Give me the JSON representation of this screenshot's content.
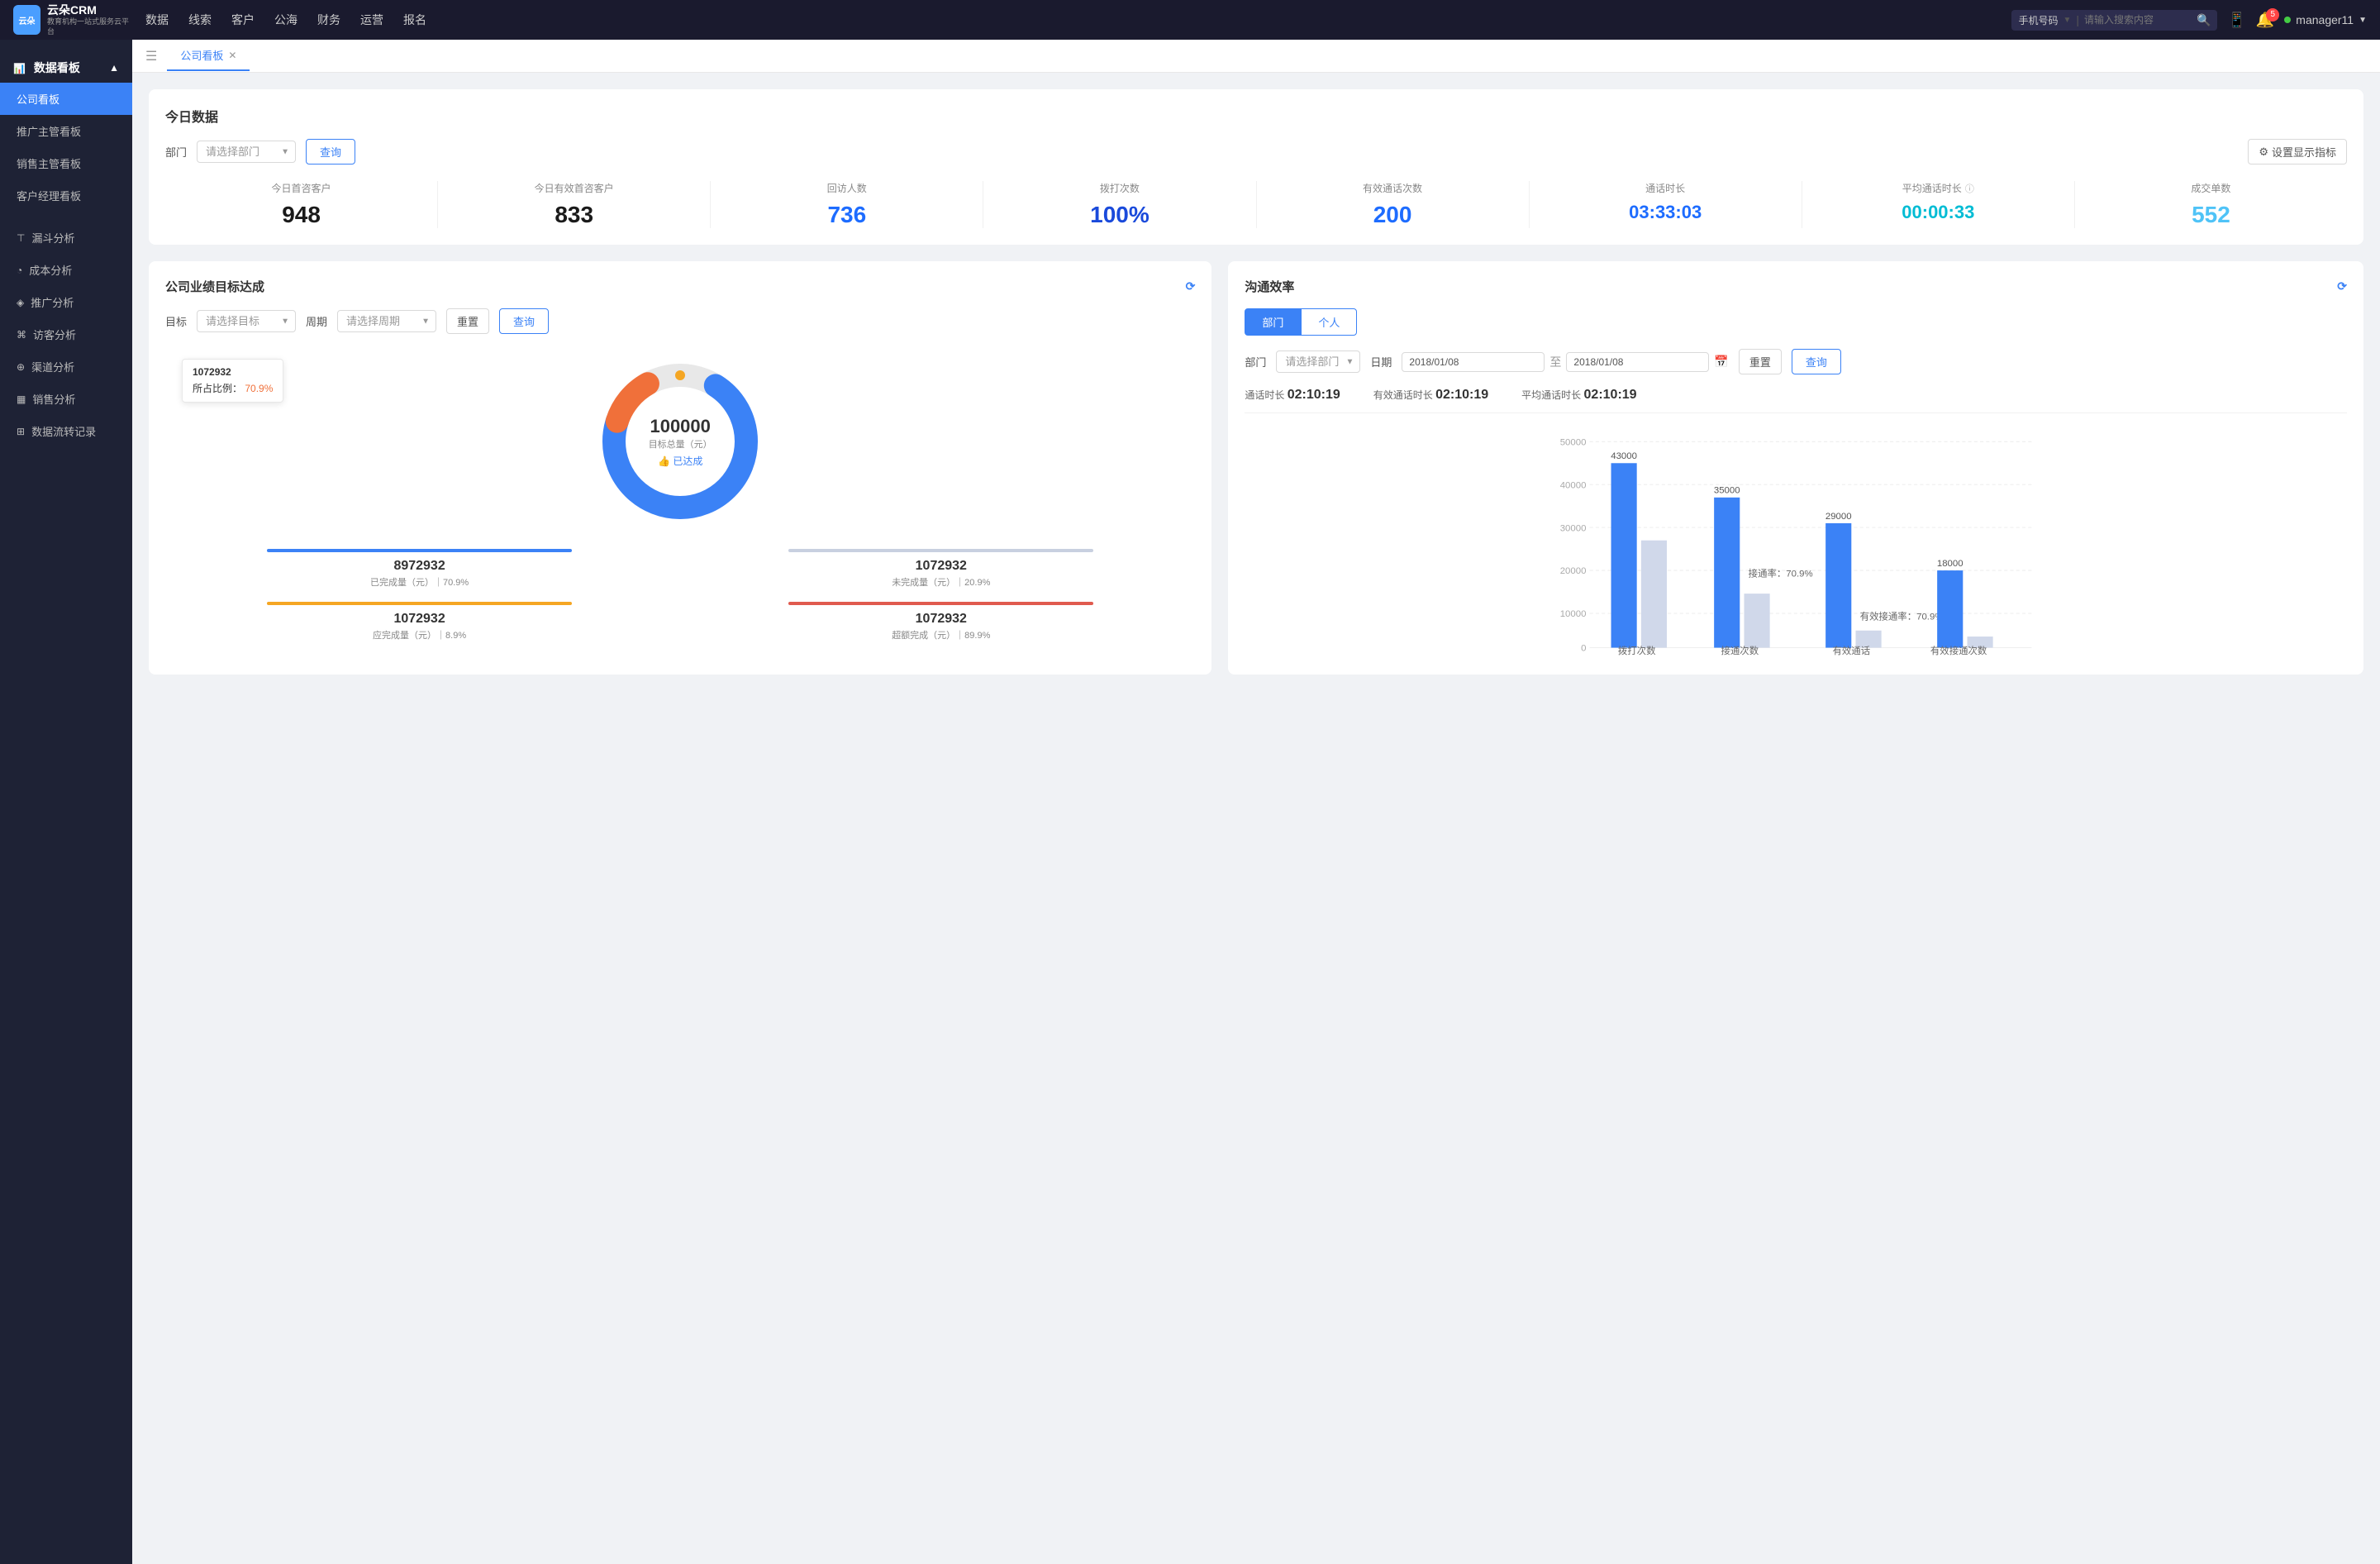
{
  "nav": {
    "logo": "云朵CRM",
    "logo_sub": "教育机构一站式服务云平台",
    "items": [
      "数据",
      "线索",
      "客户",
      "公海",
      "财务",
      "运营",
      "报名"
    ],
    "search_placeholder": "请输入搜索内容",
    "search_select": "手机号码",
    "badge_count": "5",
    "user": "manager11"
  },
  "sidebar": {
    "section_title": "数据看板",
    "items": [
      {
        "label": "公司看板",
        "active": true
      },
      {
        "label": "推广主管看板",
        "active": false
      },
      {
        "label": "销售主管看板",
        "active": false
      },
      {
        "label": "客户经理看板",
        "active": false
      },
      {
        "label": "漏斗分析",
        "active": false
      },
      {
        "label": "成本分析",
        "active": false
      },
      {
        "label": "推广分析",
        "active": false
      },
      {
        "label": "访客分析",
        "active": false
      },
      {
        "label": "渠道分析",
        "active": false
      },
      {
        "label": "销售分析",
        "active": false
      },
      {
        "label": "数据流转记录",
        "active": false
      }
    ]
  },
  "tabs": [
    {
      "label": "公司看板",
      "active": true
    }
  ],
  "today_section": {
    "title": "今日数据",
    "filter_label": "部门",
    "select_placeholder": "请选择部门",
    "query_btn": "查询",
    "settings_btn": "设置显示指标",
    "stats": [
      {
        "label": "今日首咨客户",
        "value": "948",
        "color": "black"
      },
      {
        "label": "今日有效首咨客户",
        "value": "833",
        "color": "black"
      },
      {
        "label": "回访人数",
        "value": "736",
        "color": "blue"
      },
      {
        "label": "拨打次数",
        "value": "100%",
        "color": "dark-blue"
      },
      {
        "label": "有效通话次数",
        "value": "200",
        "color": "blue"
      },
      {
        "label": "通话时长",
        "value": "03:33:03",
        "color": "blue"
      },
      {
        "label": "平均通话时长",
        "value": "00:00:33",
        "color": "cyan"
      },
      {
        "label": "成交单数",
        "value": "552",
        "color": "teal"
      }
    ]
  },
  "target_section": {
    "title": "公司业绩目标达成",
    "target_label": "目标",
    "target_placeholder": "请选择目标",
    "period_label": "周期",
    "period_placeholder": "请选择周期",
    "reset_btn": "重置",
    "query_btn": "查询",
    "donut": {
      "center_value": "100000",
      "center_label": "目标总量（元）",
      "achieved_label": "👍 已达成",
      "tooltip_value": "1072932",
      "tooltip_pct_label": "所占比例：",
      "tooltip_pct": "70.9%",
      "completed_pct": 70.9,
      "uncompleted_pct": 20.9,
      "expected_pct": 8.9,
      "over_pct": 89.9
    },
    "legend": [
      {
        "label": "8972932",
        "desc": "已完成量（元）｜70.9%",
        "color": "#3b82f6"
      },
      {
        "label": "1072932",
        "desc": "未完成量（元）｜20.9%",
        "color": "#c8d0e0"
      },
      {
        "label": "1072932",
        "desc": "应完成量（元）｜8.9%",
        "color": "#f5a623"
      },
      {
        "label": "1072932",
        "desc": "超额完成（元）｜89.9%",
        "color": "#e05a4e"
      }
    ]
  },
  "efficiency_section": {
    "title": "沟通效率",
    "tabs": [
      "部门",
      "个人"
    ],
    "active_tab": 0,
    "dept_label": "部门",
    "dept_placeholder": "请选择部门",
    "date_label": "日期",
    "date_from": "2018/01/08",
    "date_to": "2018/01/08",
    "reset_btn": "重置",
    "query_btn": "查询",
    "stats": {
      "call_duration_label": "通话时长",
      "call_duration": "02:10:19",
      "effective_label": "有效通话时长",
      "effective_val": "02:10:19",
      "avg_label": "平均通话时长",
      "avg_val": "02:10:19"
    },
    "chart": {
      "y_labels": [
        "50000",
        "40000",
        "30000",
        "20000",
        "10000",
        "0"
      ],
      "groups": [
        {
          "label": "拨打次数",
          "bars": [
            {
              "height_pct": 86,
              "value": "43000",
              "color": "#3b82f6"
            },
            {
              "height_pct": 50,
              "value": "",
              "color": "#c8d0e0"
            }
          ]
        },
        {
          "label": "接通次数",
          "annotation": "接通率：70.9%",
          "bars": [
            {
              "height_pct": 70,
              "value": "35000",
              "color": "#3b82f6"
            },
            {
              "height_pct": 25,
              "value": "",
              "color": "#c8d0e0"
            }
          ]
        },
        {
          "label": "有效通话",
          "annotation": "有效接通率：70.9%",
          "bars": [
            {
              "height_pct": 58,
              "value": "29000",
              "color": "#3b82f6"
            },
            {
              "height_pct": 8,
              "value": "",
              "color": "#c8d0e0"
            }
          ]
        },
        {
          "label": "有效接通次数",
          "bars": [
            {
              "height_pct": 36,
              "value": "18000",
              "color": "#3b82f6"
            },
            {
              "height_pct": 5,
              "value": "",
              "color": "#c8d0e0"
            }
          ]
        }
      ]
    }
  }
}
